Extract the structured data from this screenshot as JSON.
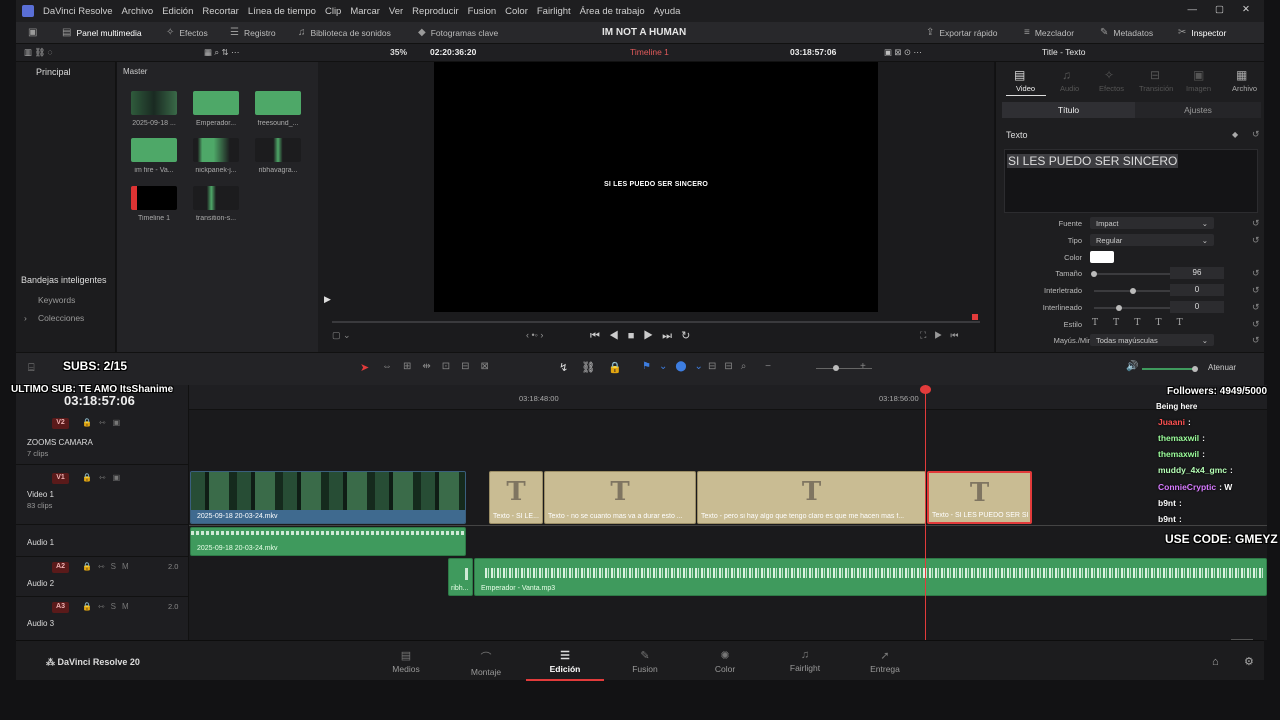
{
  "titlebar": {
    "app": "DaVinci Resolve",
    "menus": [
      "Archivo",
      "Edición",
      "Recortar",
      "Línea de tiempo",
      "Clip",
      "Marcar",
      "Ver",
      "Reproducir",
      "Fusion",
      "Color",
      "Fairlight",
      "Área de trabajo",
      "Ayuda"
    ]
  },
  "toolbar": {
    "media_pool": "Panel multimedia",
    "effects": "Efectos",
    "log": "Registro",
    "sound_lib": "Biblioteca de sonidos",
    "keyframes": "Fotogramas clave",
    "project": "IM NOT A HUMAN",
    "quick_export": "Exportar rápido",
    "mixer": "Mezclador",
    "metadata": "Metadatos",
    "inspector": "Inspector"
  },
  "subbar": {
    "zoom": "35%",
    "timecode_left": "02:20:36:20",
    "timeline": "Timeline 1",
    "timecode_right": "03:18:57:06",
    "panel_title": "Title - Texto"
  },
  "leftpanel": {
    "principal": "Principal",
    "smart_bins": "Bandejas inteligentes",
    "keywords": "Keywords",
    "collections": "Colecciones"
  },
  "bin": {
    "master": "Master",
    "clips": [
      "2025-09-18 ...",
      "Emperador...",
      "freesound_...",
      "im fire - Va...",
      "nickpanek-j...",
      "ribhavagra...",
      "Timeline 1",
      "transition-s..."
    ]
  },
  "viewer": {
    "caption": "SI LES PUEDO SER SINCERO"
  },
  "inspector": {
    "tabs": [
      "Video",
      "Audio",
      "Efectos",
      "Transición",
      "Imagen",
      "Archivo"
    ],
    "sub_title": "Título",
    "sub_settings": "Ajustes",
    "section": "Texto",
    "text_value": "SI LES PUEDO SER SINCERO",
    "font_label": "Fuente",
    "font_value": "Impact",
    "style_label": "Tipo",
    "style_value": "Regular",
    "color_label": "Color",
    "color_value": "#ffffff",
    "size_label": "Tamaño",
    "size_value": "96",
    "tracking_label": "Interletrado",
    "tracking_value": "0",
    "leading_label": "Interlineado",
    "leading_value": "0",
    "estilo_label": "Estilo",
    "case_label": "Mayús./Minús.",
    "case_value": "Todas mayúsculas"
  },
  "timeline": {
    "timecode": "03:18:57:06",
    "ruler": [
      "03:18:48:00",
      "03:18:56:00"
    ],
    "atenuar": "Atenuar",
    "tracks": [
      {
        "id": "V2",
        "name": "ZOOMS CAMARA",
        "count": "7 clips"
      },
      {
        "id": "V1",
        "name": "Video 1",
        "count": "83 clips"
      },
      {
        "id": "A1",
        "name": "Audio 1",
        "level": ""
      },
      {
        "id": "A2",
        "name": "Audio 2",
        "level": "2.0"
      },
      {
        "id": "A3",
        "name": "Audio 3",
        "level": "2.0"
      }
    ],
    "video_clip": "2025-09-18 20-03-24.mkv",
    "text_clips": [
      "Texto - SI LE...",
      "Texto - no se cuanto mas va a durar esto ...",
      "Texto - pero si hay algo que tengo claro es que me hacen mas f...",
      "Texto - SI LES PUEDO SER SI..."
    ],
    "audio1_clip": "2025-09-18 20-03-24.mkv",
    "audio2_small": "ribh...",
    "audio2_clip": "Emperador - Vanta.mp3"
  },
  "overlay": {
    "subs": "SUBS: 2/15",
    "last_sub": "ULTIMO SUB: TE AMO ItsShanime",
    "followers": "Followers: 4949/5000",
    "being": "Being here",
    "chat": [
      {
        "user": "Juaani",
        "msg": ":",
        "color": "#ff5252"
      },
      {
        "user": "themaxwil",
        "msg": ":",
        "color": "#9cff9c"
      },
      {
        "user": "themaxwil",
        "msg": ":",
        "color": "#9cff9c"
      },
      {
        "user": "muddy_4x4_gmc",
        "msg": ":",
        "color": "#b6ffb6"
      },
      {
        "user": "ConnieCryptic",
        "msg": ": W",
        "color": "#d77bff"
      },
      {
        "user": "b9nt",
        "msg": ":",
        "color": "#ffffff"
      },
      {
        "user": "b9nt",
        "msg": ":",
        "color": "#ffffff"
      }
    ],
    "code": "USE CODE: GMEYZ"
  },
  "pages": [
    "Medios",
    "Montaje",
    "Edición",
    "Fusion",
    "Color",
    "Fairlight",
    "Entrega"
  ],
  "brand": "DaVinci Resolve 20",
  "colors": {
    "accent": "#e23b3b",
    "text_clip": "#c9bc93",
    "audio_clip": "#3f9a5d"
  }
}
